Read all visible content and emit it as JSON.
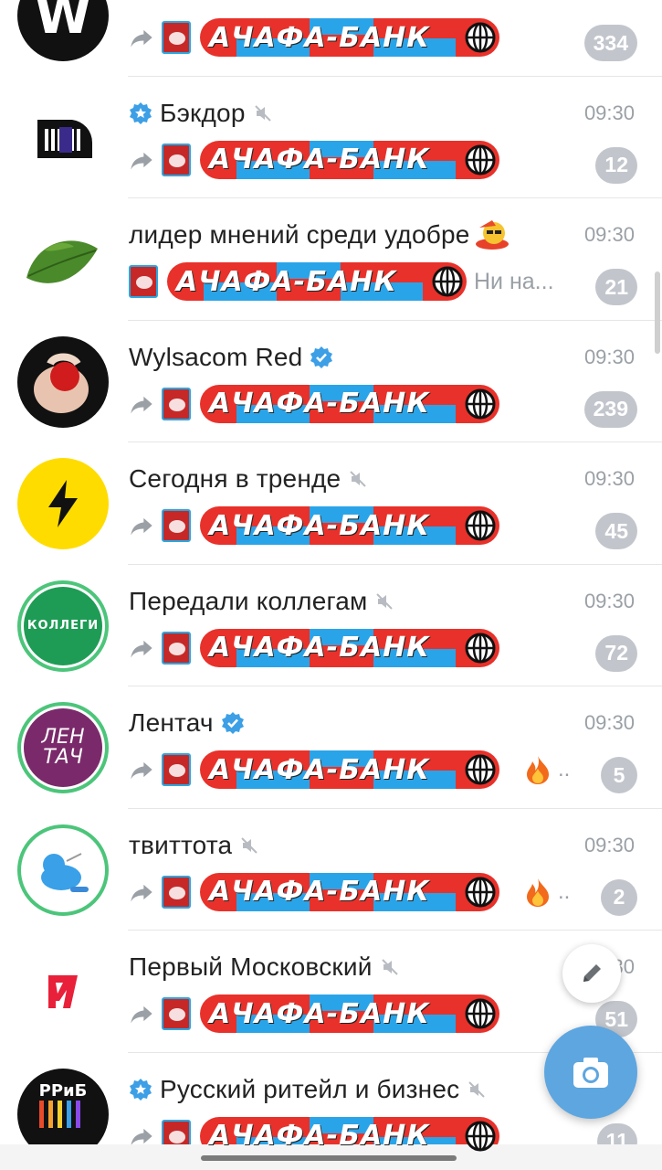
{
  "chats": [
    {
      "title": "",
      "time": "",
      "count": "334",
      "verified": false,
      "muted": false,
      "avatar": "w-logo"
    },
    {
      "title": "Бэкдор",
      "time": "09:30",
      "count": "12",
      "verified": true,
      "muted": true,
      "avatar": "backdoor-logo"
    },
    {
      "title": "лидер мнений среди удобре",
      "time": "09:30",
      "count": "21",
      "preview_text": "Ни на...",
      "avatar": "leaf"
    },
    {
      "title": "Wylsacom Red",
      "time": "09:30",
      "count": "239",
      "verified": true,
      "avatar": "hand-photo"
    },
    {
      "title": "Сегодня в тренде",
      "time": "09:30",
      "count": "45",
      "muted": true,
      "avatar": "lightning"
    },
    {
      "title": "Передали коллегам",
      "time": "09:30",
      "count": "72",
      "muted": true,
      "avatar": "kollegi"
    },
    {
      "title": "Лентач",
      "time": "09:30",
      "count": "5",
      "verified": true,
      "avatar": "lentach",
      "ellipsis": "..."
    },
    {
      "title": "твиттота",
      "time": "09:30",
      "count": "2",
      "muted": true,
      "avatar": "twitter-bird",
      "ellipsis": "..."
    },
    {
      "title": "Первый Московский",
      "time": "09:30",
      "count": "51",
      "muted": true,
      "avatar": "m-logo"
    },
    {
      "title": "Русский ритейл и бизнес",
      "time": "",
      "count": "11",
      "verified": true,
      "muted": true,
      "avatar": "rrib"
    }
  ],
  "banner_text": "АЧАФА-БАНК",
  "avatar_texts": {
    "w": "W",
    "kollegi": "КОЛЛЕГИ",
    "lentach_1": "ЛЕН",
    "lentach_2": "ТАЧ",
    "rrib": "РРиБ"
  },
  "icons": {
    "forward": "forward-arrow-icon",
    "mute": "mute-icon",
    "verified": "verified-badge-icon",
    "globe": "globe-icon",
    "fire": "fire-icon",
    "pencil": "pencil-icon",
    "camera": "camera-icon"
  },
  "colors": {
    "accent_blue": "#5ea6e0",
    "verified_blue": "#3d9fe6",
    "banner_red": "#e8312a",
    "badge_gray": "#c2c6cc"
  }
}
